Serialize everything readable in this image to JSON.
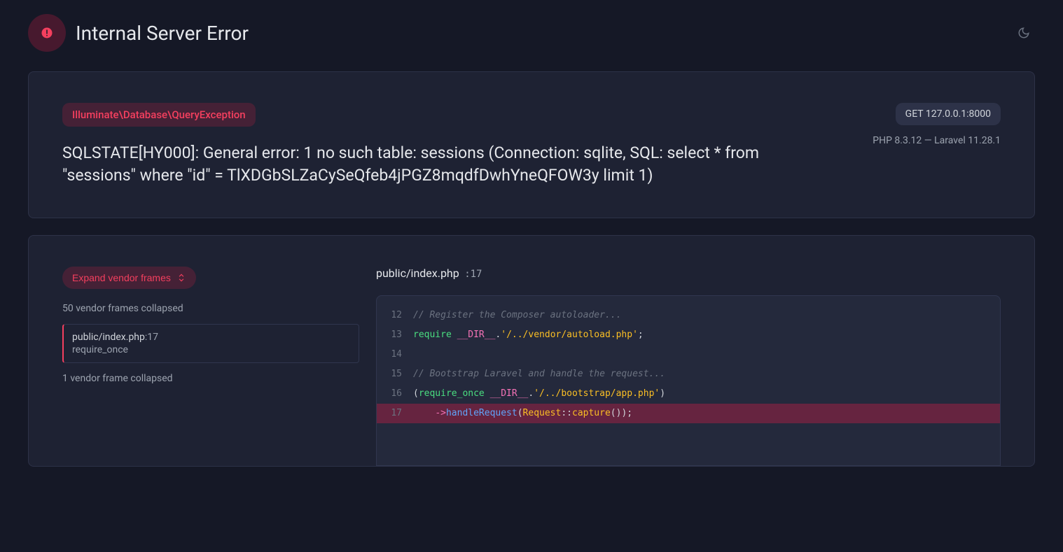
{
  "header": {
    "title": "Internal Server Error"
  },
  "error": {
    "exception": "Illuminate\\Database\\QueryException",
    "message": "SQLSTATE[HY000]: General error: 1 no such table: sessions (Connection: sqlite, SQL: select * from \"sessions\" where \"id\" = TlXDGbSLZaCySeQfeb4jPGZ8mqdfDwhYneQFOW3y limit 1)",
    "request": "GET 127.0.0.1:8000",
    "php_version": "PHP 8.3.12",
    "sep": " — ",
    "laravel_version": "Laravel 11.28.1"
  },
  "trace": {
    "expand_label": "Expand vendor frames",
    "collapsed_top": "50 vendor frames collapsed",
    "frame": {
      "path": "public/index.php",
      "line": ":17",
      "func": "require_once"
    },
    "collapsed_bottom": "1 vendor frame collapsed"
  },
  "source": {
    "file": "public/index.php",
    "line_label": " :17",
    "lines": [
      {
        "num": "12",
        "tokens": [
          {
            "t": "// Register the Composer autoloader...",
            "c": "comment"
          }
        ]
      },
      {
        "num": "13",
        "tokens": [
          {
            "t": "require",
            "c": "keyword"
          },
          {
            "t": " ",
            "c": "punc"
          },
          {
            "t": "__DIR__",
            "c": "const"
          },
          {
            "t": ".",
            "c": "punc"
          },
          {
            "t": "'/../vendor/autoload.php'",
            "c": "string"
          },
          {
            "t": ";",
            "c": "punc"
          }
        ]
      },
      {
        "num": "14",
        "tokens": []
      },
      {
        "num": "15",
        "tokens": [
          {
            "t": "// Bootstrap Laravel and handle the request...",
            "c": "comment"
          }
        ]
      },
      {
        "num": "16",
        "tokens": [
          {
            "t": "(",
            "c": "punc"
          },
          {
            "t": "require_once",
            "c": "keyword"
          },
          {
            "t": " ",
            "c": "punc"
          },
          {
            "t": "__DIR__",
            "c": "const"
          },
          {
            "t": ".",
            "c": "punc"
          },
          {
            "t": "'/../bootstrap/app.php'",
            "c": "string"
          },
          {
            "t": ")",
            "c": "punc"
          }
        ]
      },
      {
        "num": "17",
        "highlight": true,
        "indent": "    ",
        "tokens": [
          {
            "t": "->",
            "c": "op"
          },
          {
            "t": "handleRequest",
            "c": "method"
          },
          {
            "t": "(",
            "c": "punc"
          },
          {
            "t": "Request",
            "c": "class"
          },
          {
            "t": "::",
            "c": "punc"
          },
          {
            "t": "capture",
            "c": "class"
          },
          {
            "t": "());",
            "c": "punc"
          }
        ]
      }
    ]
  }
}
